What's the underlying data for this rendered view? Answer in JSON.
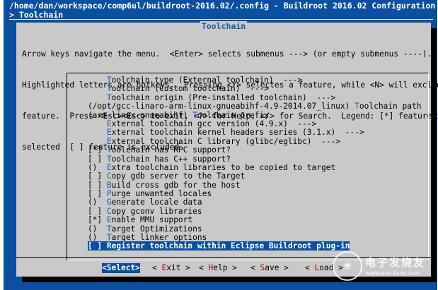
{
  "window": {
    "title": "/home/dan/workspace/comp6ul/buildroot-2016.02/.config - Buildroot 2016.02 Configuration",
    "breadcrumb": "> Toolchain"
  },
  "dialog": {
    "title": "Toolchain",
    "help_lines": [
      "Arrow keys navigate the menu.  <Enter> selects submenus ---> (or empty submenus ----).",
      "Highlighted letters are hotkeys.  Pressing <Y> selectes a feature, while <N> will exclude a",
      "feature.  Press <Esc><Esc> to exit, <?> for Help, </> for Search.  Legend: [*] feature is",
      "selected  [ ] feature is excluded"
    ]
  },
  "menu": {
    "items": [
      {
        "pre": "        ",
        "hk": "T",
        "post": "oolchain type (External toolchain)  --->"
      },
      {
        "pre": "        ",
        "hk": "T",
        "post": "oolchain (Custom toolchain)  --->"
      },
      {
        "pre": "        ",
        "hk": "T",
        "post": "oolchain origin (Pre-installed toolchain)  --->"
      },
      {
        "pre": "    (/opt/gcc-linaro-arm-linux-gnueabihf-4.9-2014.07_linux) ",
        "hk": "T",
        "post": "oolchain path"
      },
      {
        "pre": "    (arm-linux-gnueabihf) ",
        "hk": "T",
        "post": "oolchain prefix"
      },
      {
        "pre": "        ",
        "hk": "E",
        "post": "xternal toolchain gcc version (4.9.x)  --->"
      },
      {
        "pre": "        ",
        "hk": "E",
        "post": "xternal toolchain kernel headers series (3.1.x)  --->"
      },
      {
        "pre": "        ",
        "hk": "E",
        "post": "xternal toolchain C library (glibc/eglibc)  --->"
      },
      {
        "pre": "    [*] ",
        "hk": "T",
        "post": "oolchain has RPC support?"
      },
      {
        "pre": "    [ ] ",
        "hk": "T",
        "post": "oolchain has C++ support?"
      },
      {
        "pre": "    ()  ",
        "hk": "E",
        "post": "xtra toolchain libraries to be copied to target"
      },
      {
        "pre": "    [ ] ",
        "hk": "C",
        "post": "opy gdb server to the Target"
      },
      {
        "pre": "    [ ] ",
        "hk": "B",
        "post": "uild cross gdb for the host"
      },
      {
        "pre": "    [ ] ",
        "hk": "P",
        "post": "urge unwanted locales"
      },
      {
        "pre": "    ()  ",
        "hk": "G",
        "post": "enerate locale data"
      },
      {
        "pre": "    [ ] ",
        "hk": "C",
        "post": "opy gconv libraries"
      },
      {
        "pre": "    [*] ",
        "hk": "E",
        "post": "nable MMU support"
      },
      {
        "pre": "    ()  ",
        "hk": "T",
        "post": "arget Optimizations"
      },
      {
        "pre": "    ()  ",
        "hk": "T",
        "post": "arget linker options"
      },
      {
        "pre": "    [ ] ",
        "hk": "R",
        "post": "egister toolchain within Eclipse Buildroot plug-in"
      }
    ],
    "selected_index": 19
  },
  "buttons": [
    {
      "pre": "<",
      "hk": "S",
      "post": "elect>",
      "active": true
    },
    {
      "pre": "< ",
      "hk": "E",
      "post": "xit >",
      "active": false
    },
    {
      "pre": "< ",
      "hk": "H",
      "post": "elp >",
      "active": false
    },
    {
      "pre": "< ",
      "hk": "S",
      "post": "ave >",
      "active": false
    },
    {
      "pre": "< ",
      "hk": "L",
      "post": "oad >",
      "active": false
    }
  ],
  "watermark": {
    "logo_glyph": "❀",
    "brand": "电子发烧友",
    "url": "www.elecfans.com"
  }
}
